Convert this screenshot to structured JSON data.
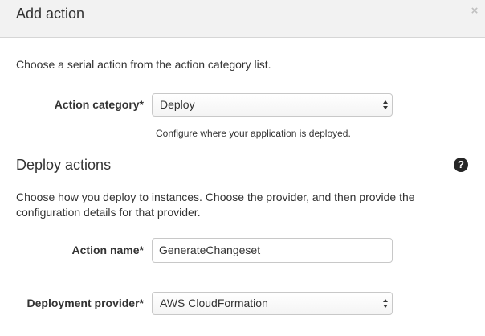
{
  "dialog": {
    "title": "Add action",
    "close_glyph": "×"
  },
  "intro_text": "Choose a serial action from the action category list.",
  "action_category": {
    "label": "Action category*",
    "selected": "Deploy",
    "help": "Configure where your application is deployed."
  },
  "deploy_section": {
    "title": "Deploy actions",
    "help_glyph": "?",
    "description": "Choose how you deploy to instances. Choose the provider, and then provide the configuration details for that provider."
  },
  "action_name": {
    "label": "Action name*",
    "value": "GenerateChangeset"
  },
  "deployment_provider": {
    "label": "Deployment provider*",
    "selected": "AWS CloudFormation"
  },
  "icons": {
    "close": "close-icon",
    "help": "help-icon",
    "select_arrows": "chevron-updown-icon"
  }
}
